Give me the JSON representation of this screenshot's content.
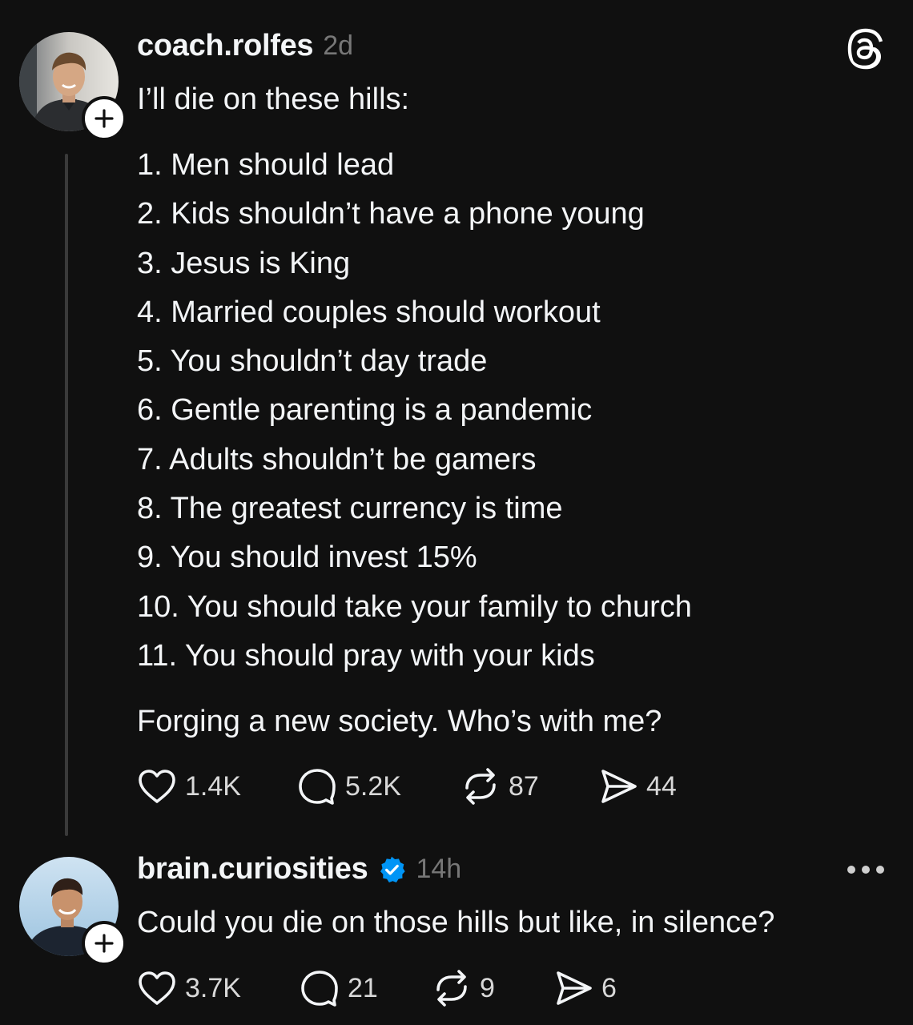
{
  "post": {
    "username": "coach.rolfes",
    "time": "2d",
    "intro": "I’ll die on these hills:",
    "list": [
      "1. Men should lead",
      "2. Kids shouldn’t have a phone young",
      "3. Jesus is King",
      "4. Married couples should workout",
      "5. You shouldn’t day trade",
      "6. Gentle parenting is a pandemic",
      "7. Adults shouldn’t be gamers",
      "8. The greatest currency is time",
      "9. You should invest 15%",
      "10. You should take your family to church",
      "11. You should pray with your kids"
    ],
    "closing": "Forging a new society. Who’s with me?",
    "stats": {
      "likes": "1.4K",
      "replies": "5.2K",
      "reposts": "87",
      "shares": "44"
    }
  },
  "reply": {
    "username": "brain.curiosities",
    "time": "14h",
    "text": "Could you die on those hills but like, in silence?",
    "stats": {
      "likes": "3.7K",
      "replies": "21",
      "reposts": "9",
      "shares": "6"
    }
  },
  "icons": {
    "app": "threads-logo-icon",
    "follow": "plus-icon",
    "like": "heart-icon",
    "reply": "comment-icon",
    "repost": "repost-icon",
    "share": "send-icon",
    "verified": "verified-badge-icon",
    "more": "more-icon"
  },
  "colors": {
    "background": "#101010",
    "text": "#f3f5f7",
    "muted": "#777777",
    "verified": "#0095f6"
  }
}
